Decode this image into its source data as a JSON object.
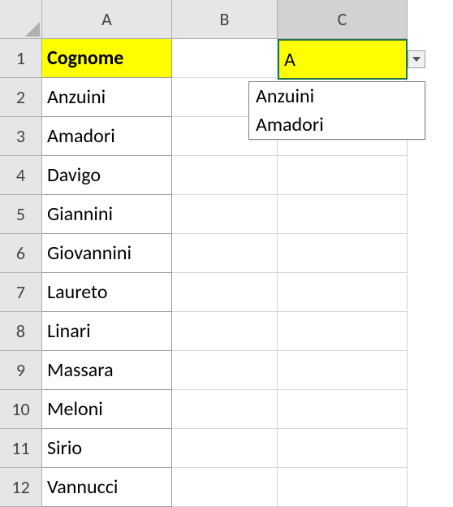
{
  "columns": [
    "A",
    "B",
    "C"
  ],
  "selectedColumn": "C",
  "rows": [
    1,
    2,
    3,
    4,
    5,
    6,
    7,
    8,
    9,
    10,
    11,
    12
  ],
  "header": "Cognome",
  "data": [
    "Anzuini",
    "Amadori",
    "Davigo",
    "Giannini",
    "Giovannini",
    "Laureto",
    "Linari",
    "Massara",
    "Meloni",
    "Sirio",
    "Vannucci"
  ],
  "activeCell": {
    "value": "A"
  },
  "dropdown": {
    "items": [
      "Anzuini",
      "Amadori"
    ]
  }
}
